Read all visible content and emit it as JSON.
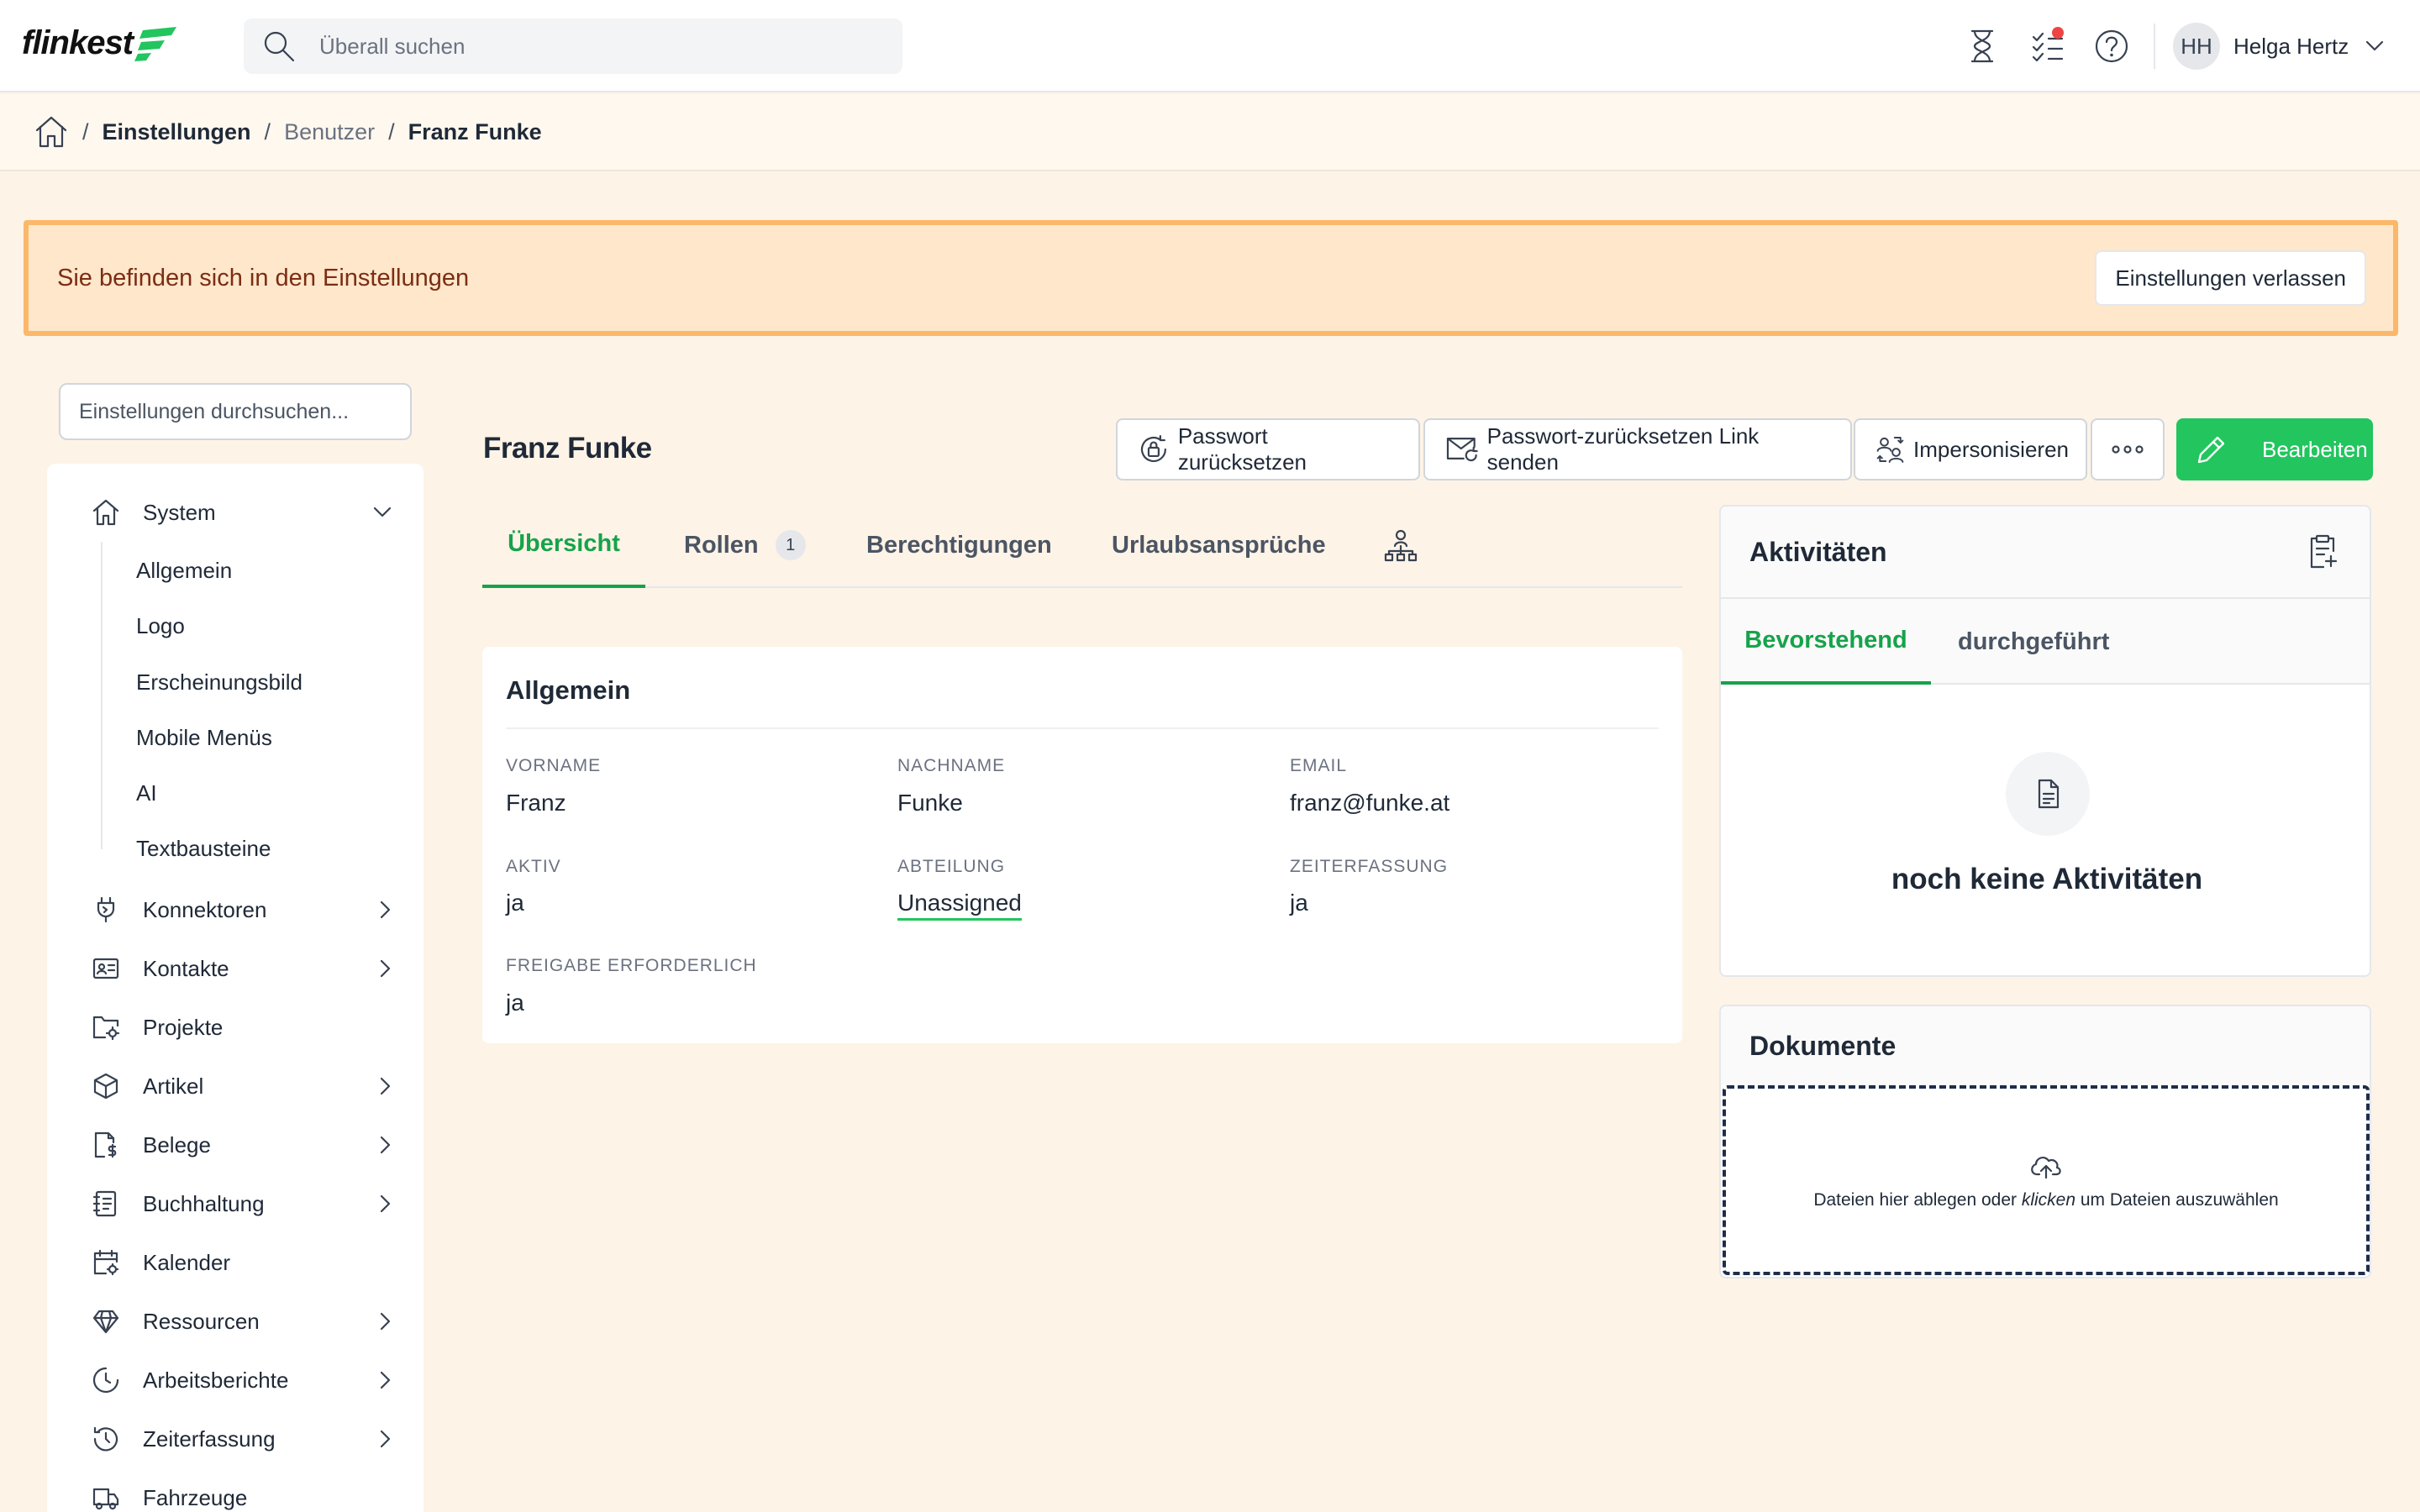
{
  "app": {
    "logo_text": "flinkest",
    "brand_color": "#22c55e"
  },
  "topbar": {
    "search_placeholder": "Überall suchen",
    "icons": [
      "hourglass-icon",
      "tasks-icon",
      "help-icon"
    ],
    "user": {
      "initials": "HH",
      "name": "Helga Hertz"
    }
  },
  "breadcrumb": {
    "items": [
      "Einstellungen",
      "Benutzer",
      "Franz Funke"
    ]
  },
  "banner": {
    "text": "Sie befinden sich in den Einstellungen",
    "button": "Einstellungen verlassen"
  },
  "sidebar": {
    "search_placeholder": "Einstellungen durchsuchen...",
    "items": [
      {
        "label": "System",
        "icon": "home-icon"
      },
      {
        "label": "Konnektoren",
        "icon": "plug-icon"
      },
      {
        "label": "Kontakte",
        "icon": "contact-card-icon"
      },
      {
        "label": "Projekte",
        "icon": "folder-gear-icon"
      },
      {
        "label": "Artikel",
        "icon": "box-icon"
      },
      {
        "label": "Belege",
        "icon": "receipt-icon"
      },
      {
        "label": "Buchhaltung",
        "icon": "ledger-icon"
      },
      {
        "label": "Kalender",
        "icon": "calendar-icon"
      },
      {
        "label": "Ressourcen",
        "icon": "diamond-icon"
      },
      {
        "label": "Arbeitsberichte",
        "icon": "clock-icon"
      },
      {
        "label": "Zeiterfassung",
        "icon": "history-icon"
      },
      {
        "label": "Fahrzeuge",
        "icon": "truck-icon"
      }
    ],
    "system_children": [
      "Allgemein",
      "Logo",
      "Erscheinungsbild",
      "Mobile Menüs",
      "AI",
      "Textbausteine"
    ]
  },
  "user_page": {
    "title": "Franz Funke",
    "actions": {
      "reset_password": "Passwort zurücksetzen",
      "send_reset_link": "Passwort-zurücksetzen Link senden",
      "impersonate": "Impersonisieren",
      "edit": "Bearbeiten"
    },
    "tabs": {
      "overview": "Übersicht",
      "roles": "Rollen",
      "roles_count": "1",
      "permissions": "Berechtigungen",
      "vacation": "Urlaubsansprüche"
    }
  },
  "general": {
    "title": "Allgemein",
    "fields": {
      "first_name": {
        "label": "VORNAME",
        "value": "Franz"
      },
      "last_name": {
        "label": "NACHNAME",
        "value": "Funke"
      },
      "email": {
        "label": "EMAIL",
        "value": "franz@funke.at"
      },
      "active": {
        "label": "AKTIV",
        "value": "ja"
      },
      "department": {
        "label": "ABTEILUNG",
        "value": "Unassigned"
      },
      "time_tracking": {
        "label": "ZEITERFASSUNG",
        "value": "ja"
      },
      "approval": {
        "label": "FREIGABE ERFORDERLICH",
        "value": "ja"
      }
    }
  },
  "activities": {
    "title": "Aktivitäten",
    "tabs": [
      "Bevorstehend",
      "durchgeführt"
    ],
    "empty": "noch keine Aktivitäten"
  },
  "documents": {
    "title": "Dokumente",
    "drop_before": "Dateien hier ablegen oder ",
    "drop_em": "klicken",
    "drop_after": " um Dateien auszuwählen"
  }
}
